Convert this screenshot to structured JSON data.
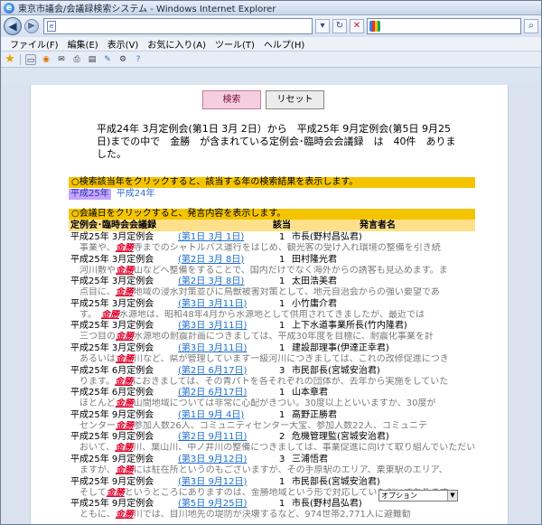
{
  "window": {
    "title": "東京市議会/会議録検索システム - Windows Internet Explorer",
    "url": "e",
    "search_placeholder": ""
  },
  "menu": [
    "ファイル(F)",
    "編集(E)",
    "表示(V)",
    "お気に入り(A)",
    "ツール(T)",
    "ヘルプ(H)"
  ],
  "buttons": {
    "search": "検索",
    "reset": "リセット"
  },
  "summary": "平成24年 3月定例会(第1日 3月 2日）から　平成25年 9月定例会(第5日 9月25日)までの中で　金勝　が含まれている定例会･臨時会会議録　は　40件　ありました。",
  "info_year": "○検索該当年をクリックすると、該当する年の検索結果を表示します。",
  "years": [
    "平成25年",
    "平成24年"
  ],
  "info_date": "○会議日をクリックすると、発言内容を表示します。",
  "table_header": {
    "col1": "定例会･臨時会会議録",
    "col2": "該当",
    "col3": "発言者名"
  },
  "records": [
    {
      "session": "平成25年 3月定例会",
      "date": "(第1日 3月 1日)",
      "count": "1",
      "speaker": "市長(野村昌弘君)",
      "pre": "事業や、",
      "kw": "金勝",
      "post": "寺までのシャトルバス運行をはじめ、観光客の受け入れ環境の整備を引き続"
    },
    {
      "session": "平成25年 3月定例会",
      "date": "(第2日 3月 8日)",
      "count": "1",
      "speaker": "田村隆光君",
      "pre": "河川敷や",
      "kw": "金勝",
      "post": "山などへ整備をすることで、国内だけでなく海外からの誘客も見込めます。ま"
    },
    {
      "session": "平成25年 3月定例会",
      "date": "(第2日 3月 8日)",
      "count": "1",
      "speaker": "太田浩美君",
      "pre": "点目に、",
      "kw": "金勝",
      "post": "地域の浸水対策並びに鳥獣被害対策として、地元自治会からの強い要望であ"
    },
    {
      "session": "平成25年 3月定例会",
      "date": "(第3日 3月11日)",
      "count": "1",
      "speaker": "小竹庸介君",
      "pre": "す。　",
      "kw": "金勝",
      "post": "水源地は、昭和48年4月から水源地として供用されてきましたが、最近では"
    },
    {
      "session": "平成25年 3月定例会",
      "date": "(第3日 3月11日)",
      "count": "1",
      "speaker": "上下水道事業所長(竹内隆君)",
      "pre": "三つ目の",
      "kw": "金勝",
      "post": "水源地の耐震計画につきましては、平成30年度を目標に、耐震化事業を計"
    },
    {
      "session": "平成25年 3月定例会",
      "date": "(第3日 3月11日)",
      "count": "1",
      "speaker": "建設部理事(伊達正幸君)",
      "pre": "あるいは",
      "kw": "金勝",
      "post": "川など、県が管理しています一級河川につきましては、これの改修促進につき"
    },
    {
      "session": "平成25年 6月定例会",
      "date": "(第2日 6月17日)",
      "count": "3",
      "speaker": "市民部長(宮城安治君)",
      "pre": "ります。",
      "kw": "金勝",
      "post": "におきましては、その青パトを各それぞれの団体が、去年から実施をしていた"
    },
    {
      "session": "平成25年 6月定例会",
      "date": "(第2日 6月17日)",
      "count": "1",
      "speaker": "山本章君",
      "pre": "ほとんど",
      "kw": "金勝",
      "post": "山間地域については非常に心配がきつい。30度以上といいますか、30度が"
    },
    {
      "session": "平成25年 9月定例会",
      "date": "(第1日 9月 4日)",
      "count": "1",
      "speaker": "高野正勝君",
      "pre": "センター",
      "kw": "金勝",
      "post": "参加人数26人、コミュニティセンター大宝、参加人数22人、コミュニテ"
    },
    {
      "session": "平成25年 9月定例会",
      "date": "(第2日 9月11日)",
      "count": "2",
      "speaker": "危機管理監(宮城安治君)",
      "pre": "おいて、",
      "kw": "金勝",
      "post": "川、葉山川、中ノ井川の整備につきましては、事業促進に向けて取り組んでいただい"
    },
    {
      "session": "平成25年 9月定例会",
      "date": "(第3日 9月12日)",
      "count": "3",
      "speaker": "三浦悟君",
      "pre": "ますが、",
      "kw": "金勝",
      "post": "には駐在所というのもございますが、その手原駅のエリア、栗東駅のエリア、"
    },
    {
      "session": "平成25年 9月定例会",
      "date": "(第3日 9月12日)",
      "count": "1",
      "speaker": "市民部長(宮城安治君)",
      "pre": "そして",
      "kw": "金勝",
      "post": "というところにありますのは、金勝地域という形で対応していただいております。"
    },
    {
      "session": "平成25年 9月定例会",
      "date": "(第5日 9月25日)",
      "count": "1",
      "speaker": "市長(野村昌弘君)",
      "pre": "ともに、",
      "kw": "金勝",
      "post": "川では、目川地先の堤防が決壊するなど、974世帯2,771人に避難勧"
    }
  ],
  "option_select": "オプション"
}
